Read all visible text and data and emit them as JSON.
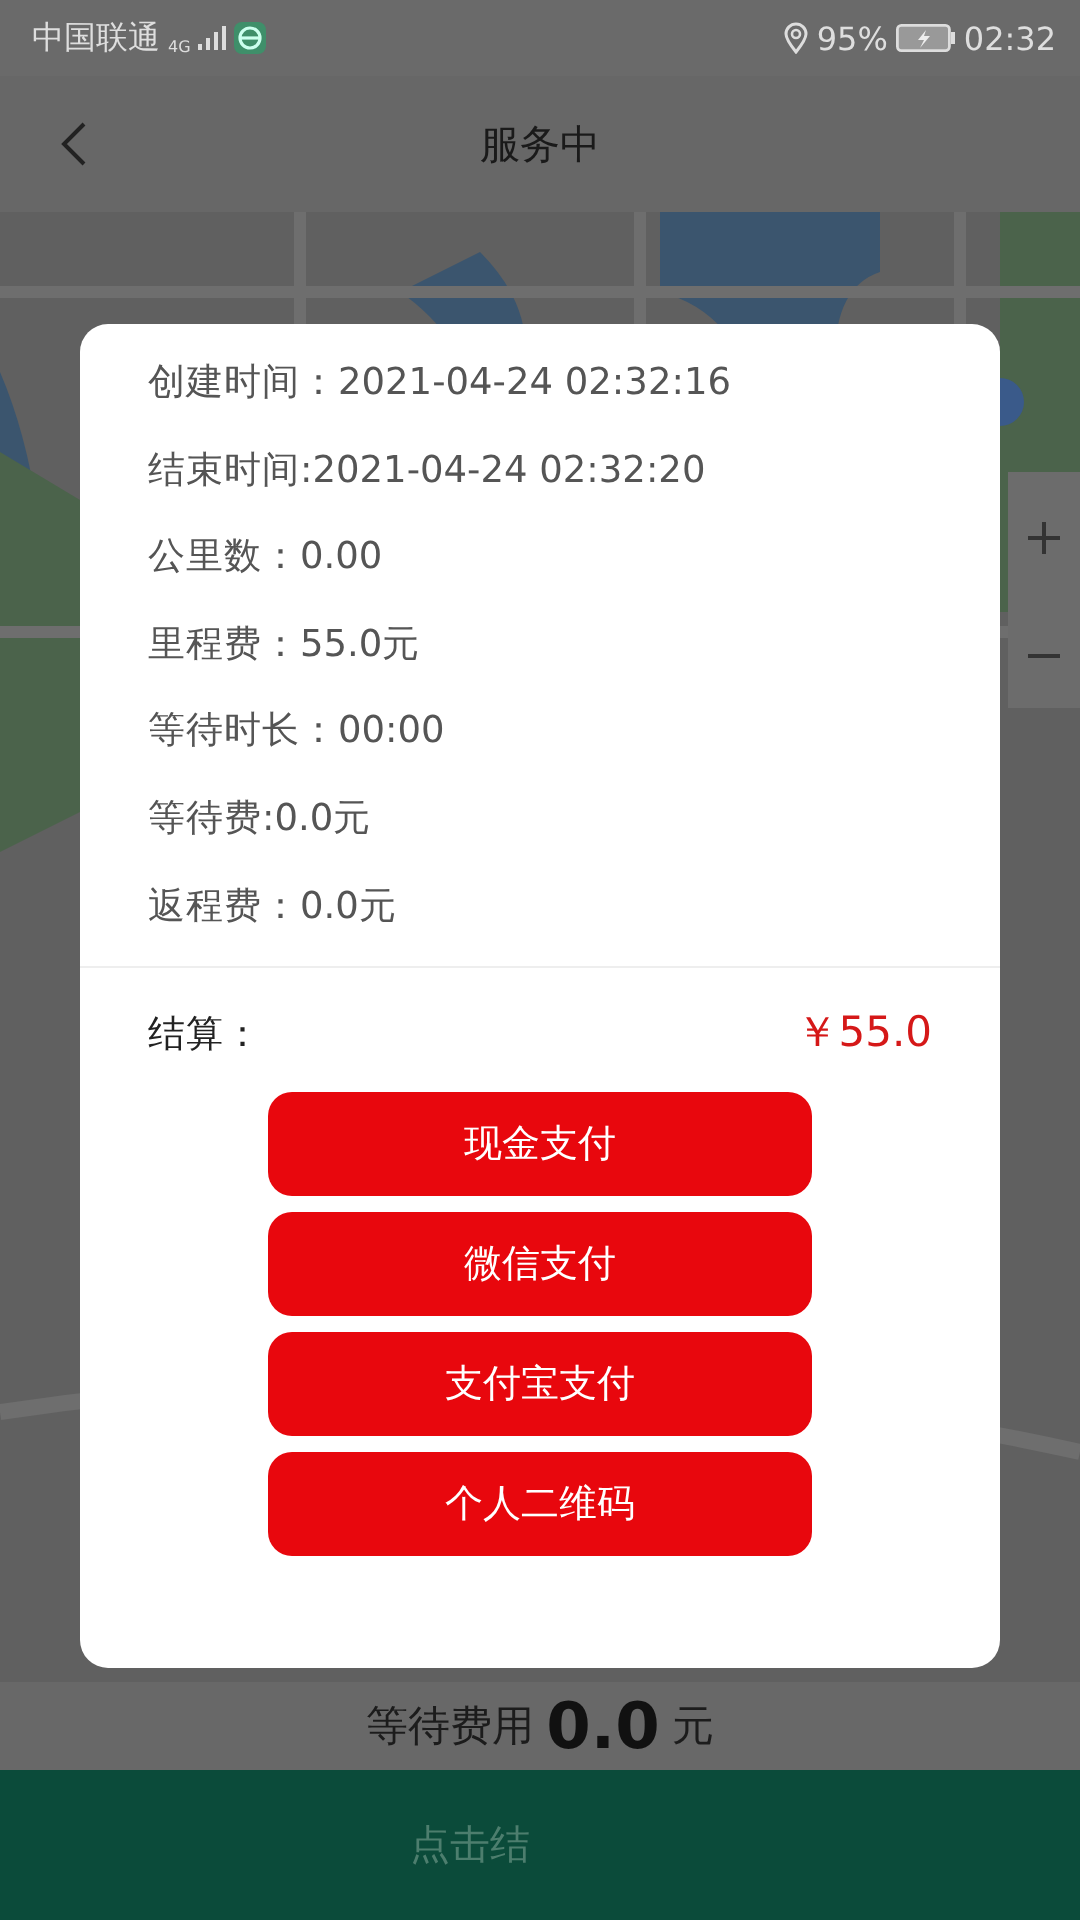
{
  "status_bar": {
    "carrier": "中国联通",
    "network": "4G",
    "battery": "95%",
    "time": "02:32"
  },
  "header": {
    "title": "服务中"
  },
  "dialog": {
    "details": [
      "创建时间：2021-04-24 02:32:16",
      "结束时间:2021-04-24 02:32:20",
      "公里数：0.00",
      "里程费：55.0元",
      "等待时长：00:00",
      "等待费:0.0元",
      "返程费：0.0元"
    ],
    "total": {
      "label": "结算：",
      "amount": "￥55.0"
    },
    "buttons": [
      "现金支付",
      "微信支付",
      "支付宝支付",
      "个人二维码"
    ]
  },
  "wait_fee": {
    "label": "等待费用",
    "value": "0.0",
    "unit": "元"
  },
  "action_bar": {
    "label": "点击结"
  }
}
